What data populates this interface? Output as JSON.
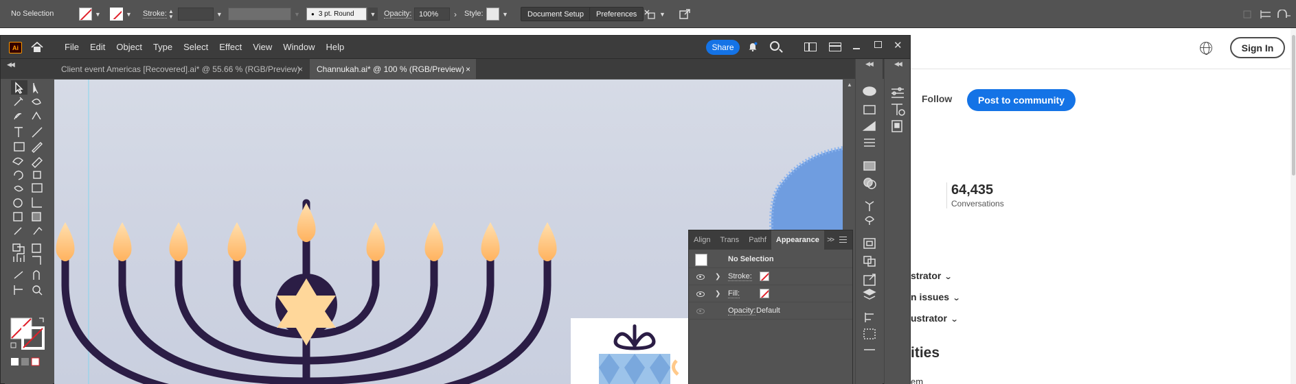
{
  "control_bar": {
    "selection": "No Selection",
    "stroke_label": "Stroke:",
    "stroke_weight": "",
    "brush_label": "3 pt. Round",
    "opacity_label": "Opacity:",
    "opacity_value": "100%",
    "style_label": "Style:",
    "document_setup": "Document Setup",
    "preferences": "Preferences"
  },
  "web": {
    "sign_in": "Sign In",
    "follow": "Follow",
    "post_to_community": "Post to community",
    "stat_number": "64,435",
    "stat_label": "Conversations",
    "links": [
      "strator",
      "n issues",
      "ustrator"
    ],
    "heading": "ities",
    "small": "em"
  },
  "app": {
    "logo": "Ai",
    "menu": [
      "File",
      "Edit",
      "Object",
      "Type",
      "Select",
      "Effect",
      "View",
      "Window",
      "Help"
    ],
    "share": "Share",
    "tabs": [
      {
        "label": "Client event Americas [Recovered].ai* @ 55.66 % (RGB/Preview)",
        "close": "×"
      },
      {
        "label": "Channukah.ai* @ 100 % (RGB/Preview)",
        "close": "×"
      }
    ]
  },
  "appearance_panel": {
    "tabs": [
      "Align",
      "Trans",
      "Pathf",
      "Appearance"
    ],
    "more": ">>",
    "title": "No Selection",
    "rows": [
      {
        "key": "Stroke:",
        "value": ""
      },
      {
        "key": "Fill:",
        "value": ""
      },
      {
        "key": "Opacity:",
        "value": "Default"
      }
    ]
  },
  "colors": {
    "accent": "#1473e6",
    "menorah": "#2b1d45",
    "flame": "#ffc98a",
    "star": "#ffd79a"
  }
}
